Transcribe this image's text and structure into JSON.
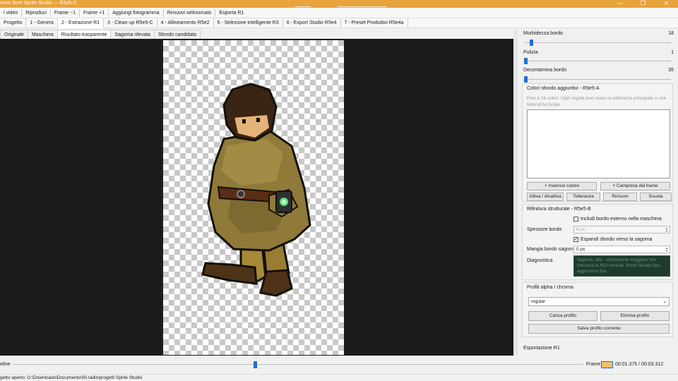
{
  "window": {
    "title": "inum Sunt Sprite Studio — R5e5-C",
    "controls": {
      "minimize": "—",
      "maximize": "❐",
      "close": "✕"
    }
  },
  "menu": {
    "items": [
      "i video",
      "Riproduci",
      "Frame −1",
      "Frame +1",
      "Aggiungi fotogramma",
      "Rimuovi selezionato",
      "Esporta R1"
    ]
  },
  "stages": {
    "items": [
      "Progetto",
      "1 - Genera",
      "2 - Estrazione R1",
      "3 - Clean-up R5e5-C",
      "4 - Allineamento R5e2",
      "5 - Selezione intelligente R3",
      "6 - Export Studio R5e4",
      "7 - Preset Produttivi R5e4a"
    ],
    "active": 2
  },
  "view_tabs": {
    "items": [
      "Originale",
      "Maschera",
      "Risultato trasparente",
      "Sagoma rilevata",
      "Sfondo candidato"
    ],
    "active": 2
  },
  "panel": {
    "sliders": [
      {
        "label": "Morbidezza bordo",
        "value": "18",
        "fraction": 0.04
      },
      {
        "label": "Pulizia",
        "value": "1",
        "fraction": 0.0
      },
      {
        "label": "Decontamina bordo",
        "value": "35",
        "fraction": 0.0
      }
    ],
    "colors_group": {
      "title": "Colori sfondo aggiuntivi - R5e5-A",
      "hint": "Fino a 16 colori. Ogni regola può usare la tolleranza principale o una tolleranza locale.",
      "insert_btn": "+ Inserisci colore",
      "sample_btn": "+ Campiona dal frame",
      "toggle_btn": "Attiva / disattiva",
      "tolerance_btn": "Tolleranza",
      "remove_btn": "Rimuovi",
      "clear_btn": "Svuota"
    },
    "refine_group": {
      "title": "Rifinitura strutturale - R5e5-B",
      "include_border_label": "Includi bordo esterno nella maschera",
      "include_border_checked": false,
      "thickness_label": "Spessore bordo",
      "thickness_value": "8 px",
      "expand_bg_label": "Espandi sfondo verso la sagoma",
      "expand_bg_checked": true,
      "erode_label": "Mangia bordo sagoma",
      "erode_value": "0 px",
      "diag_label": "Diagnostica",
      "diag_text": "Sagoma: alta · componente maggiore che interseca la ROI centrale. Bordo forzato 5px, aggiunzioni 5px."
    },
    "profiles_group": {
      "title": "Profili alpha / chroma",
      "selected": "regular",
      "load_btn": "Carica profilo",
      "delete_btn": "Elimina profilo",
      "save_btn": "Salva profilo corrente"
    },
    "export_title": "Esportazione R1"
  },
  "timeline": {
    "label": "eline",
    "position_fraction": 0.425,
    "frame_label": "Frame",
    "frame_value": "",
    "time": "00:01.375 / 00:03.312"
  },
  "status": {
    "text": "getto aperto: G:\\Downloads\\Documents\\00.radix\\progetti Sprite Studio"
  },
  "colors": {
    "accent": "#1f6fd1",
    "titlebar": "#e8a33c",
    "canvas_bg": "#1b1b1b",
    "diag_bg": "#1e3b2c"
  }
}
